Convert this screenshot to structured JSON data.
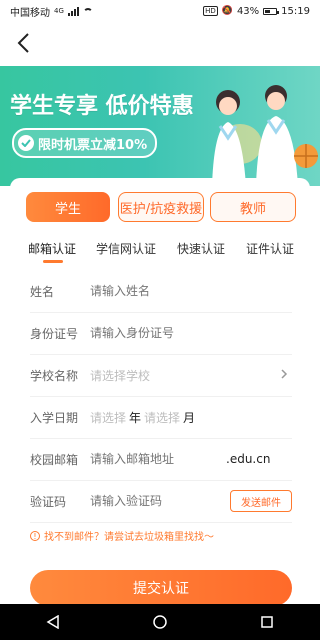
{
  "status_bar": {
    "carrier": "中国移动",
    "network": "4G",
    "battery": "43%",
    "time": "15:19"
  },
  "header": {
    "back_icon": "chevron-left-icon"
  },
  "banner": {
    "title": "学生专享 低价特惠",
    "subtitle": "限时机票立减10%"
  },
  "roles": [
    {
      "label": "学生",
      "selected": true
    },
    {
      "label": "医护/抗疫救援",
      "selected": false
    },
    {
      "label": "教师",
      "selected": false
    }
  ],
  "methods": [
    {
      "label": "邮箱认证",
      "active": true
    },
    {
      "label": "学信网认证",
      "active": false
    },
    {
      "label": "快速认证",
      "active": false
    },
    {
      "label": "证件认证",
      "active": false
    }
  ],
  "form": {
    "name": {
      "label": "姓名",
      "placeholder": "请输入姓名"
    },
    "id_number": {
      "label": "身份证号",
      "placeholder": "请输入身份证号"
    },
    "school": {
      "label": "学校名称",
      "placeholder": "请选择学校"
    },
    "enroll_date": {
      "label": "入学日期",
      "placeholder_year": "请选择",
      "year_unit": "年",
      "placeholder_month": "请选择",
      "month_unit": "月"
    },
    "email": {
      "label": "校园邮箱",
      "placeholder": "请输入邮箱地址",
      "suffix": ".edu.cn"
    },
    "code": {
      "label": "验证码",
      "placeholder": "请输入验证码",
      "send_button": "发送邮件"
    }
  },
  "hint": "找不到邮件？请尝试去垃圾箱里找找～",
  "submit_label": "提交认证",
  "colors": {
    "accent": "#ff6a2a",
    "banner": "#3cc4b2"
  }
}
